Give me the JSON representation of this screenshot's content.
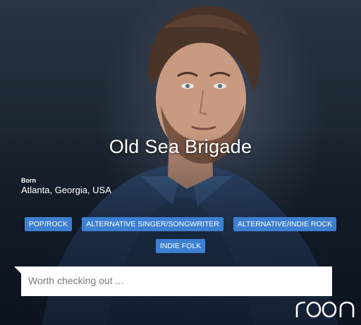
{
  "artist": {
    "name": "Old Sea Brigade",
    "born_label": "Born",
    "born_value": "Atlanta, Georgia, USA"
  },
  "genres": [
    "POP/ROCK",
    "ALTERNATIVE SINGER/SONGWRITER",
    "ALTERNATIVE/INDIE ROCK",
    "INDIE FOLK"
  ],
  "note": {
    "placeholder": "Worth checking out ..."
  },
  "brand": {
    "logo_text": "roon"
  },
  "colors": {
    "genre_tag": "#3d7fd1",
    "title_text": "#ffffff"
  }
}
